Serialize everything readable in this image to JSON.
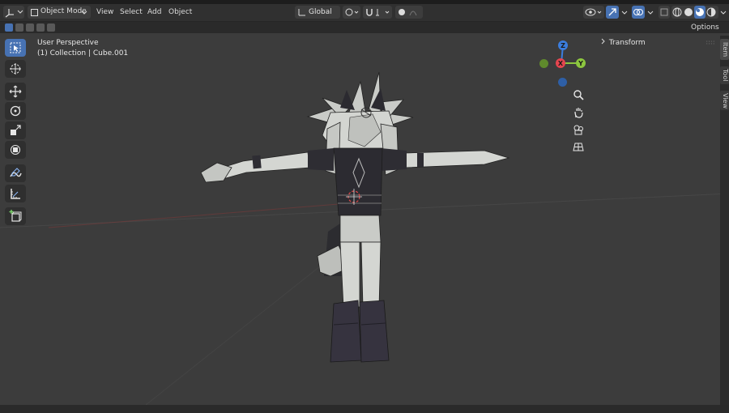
{
  "header": {
    "editor_type_icon": "axes-icon",
    "mode_label": "Object Mode",
    "menus": [
      "View",
      "Select",
      "Add",
      "Object"
    ],
    "transform_orientation": "Global",
    "options_label": "Options",
    "accent_color": "#4772b3"
  },
  "viewport": {
    "perspective_label": "User Perspective",
    "collection_label": "(1) Collection | Cube.001",
    "background_color": "#3c3c3c"
  },
  "gizmo": {
    "x_label": "X",
    "y_label": "Y",
    "z_label": "Z",
    "x_color": "#e5454f",
    "y_color": "#8cc63f",
    "z_color": "#3b7ddd"
  },
  "npanel": {
    "section_title": "Transform",
    "tabs": [
      "Item",
      "Tool",
      "View"
    ]
  },
  "toolbar": {
    "tools": [
      "select-box",
      "cursor",
      "move",
      "rotate",
      "scale",
      "transform",
      "annotate",
      "measure",
      "add-cube"
    ]
  }
}
